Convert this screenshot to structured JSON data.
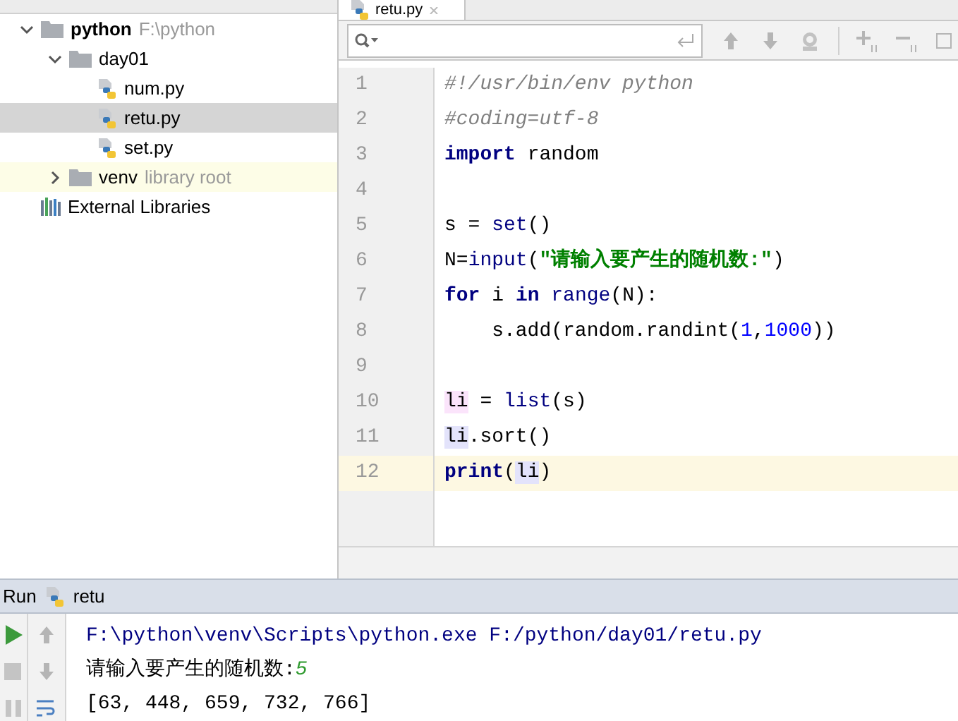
{
  "project_tree": [
    {
      "label": "python",
      "detail": "F:\\python",
      "kind": "folder",
      "bold": true,
      "expanded": true,
      "children": [
        {
          "label": "day01",
          "kind": "folder",
          "expanded": true,
          "children": [
            {
              "label": "num.py",
              "kind": "file",
              "selected": false
            },
            {
              "label": "retu.py",
              "kind": "file",
              "selected": true
            },
            {
              "label": "set.py",
              "kind": "file",
              "selected": false
            }
          ]
        },
        {
          "label": "venv",
          "detail": "library root",
          "kind": "folder",
          "expanded": false
        }
      ]
    },
    {
      "label": "External Libraries",
      "kind": "libraries"
    }
  ],
  "editor_tab": {
    "label": "retu.py"
  },
  "code_lines": [
    {
      "number": "1",
      "current": false,
      "tokens": [
        {
          "text": "#!/usr/bin/env python",
          "kind": "comment"
        }
      ]
    },
    {
      "number": "2",
      "current": false,
      "tokens": [
        {
          "text": "#coding=utf-8",
          "kind": "comment"
        }
      ]
    },
    {
      "number": "3",
      "current": false,
      "tokens": [
        {
          "text": "import",
          "kind": "keyword"
        },
        {
          "text": " random",
          "kind": "plain"
        }
      ]
    },
    {
      "number": "4",
      "current": false
    },
    {
      "number": "5",
      "current": false,
      "tokens": [
        {
          "text": "s = ",
          "kind": "plain"
        },
        {
          "text": "set",
          "kind": "builtin"
        },
        {
          "text": "()",
          "kind": "plain"
        }
      ]
    },
    {
      "number": "6",
      "current": false,
      "tokens": [
        {
          "text": "N=",
          "kind": "plain"
        },
        {
          "text": "input",
          "kind": "builtin"
        },
        {
          "text": "(",
          "kind": "plain"
        },
        {
          "text": "\"请输入要产生的随机数:\"",
          "kind": "string"
        },
        {
          "text": ")",
          "kind": "plain"
        }
      ]
    },
    {
      "number": "7",
      "current": false,
      "tokens": [
        {
          "text": "for",
          "kind": "keyword"
        },
        {
          "text": " i ",
          "kind": "plain"
        },
        {
          "text": "in",
          "kind": "keyword"
        },
        {
          "text": " range",
          "kind": "builtin"
        },
        {
          "text": "(N):",
          "kind": "plain"
        }
      ]
    },
    {
      "number": "8",
      "current": false,
      "tokens": [
        {
          "text": "    s.add(random.randint(",
          "kind": "plain"
        },
        {
          "text": "1",
          "kind": "number"
        },
        {
          "text": ",",
          "kind": "plain"
        },
        {
          "text": "1000",
          "kind": "number"
        },
        {
          "text": "))",
          "kind": "plain"
        }
      ]
    },
    {
      "number": "9",
      "current": false
    },
    {
      "number": "10",
      "current": false,
      "tokens": [
        {
          "text": "li",
          "kind": "write_usage"
        },
        {
          "text": " = ",
          "kind": "plain"
        },
        {
          "text": "list",
          "kind": "builtin"
        },
        {
          "text": "(s)",
          "kind": "plain"
        }
      ]
    },
    {
      "number": "11",
      "current": false,
      "tokens": [
        {
          "text": "li",
          "kind": "read_usage"
        },
        {
          "text": ".sort()",
          "kind": "plain"
        }
      ]
    },
    {
      "number": "12",
      "current": true,
      "tokens": [
        {
          "text": "print",
          "kind": "keyword"
        },
        {
          "text": "(",
          "kind": "plain"
        },
        {
          "text": "li",
          "kind": "read_usage"
        },
        {
          "text": ")",
          "kind": "plain"
        }
      ]
    }
  ],
  "run_panel": {
    "title": "Run",
    "config": "retu",
    "output": [
      {
        "parts": [
          {
            "text": "F:\\python\\venv\\Scripts\\python.exe F:/python/day01/retu.py",
            "kind": "command"
          }
        ]
      },
      {
        "parts": [
          {
            "text": "请输入要产生的随机数:",
            "kind": "normal"
          },
          {
            "text": "5",
            "kind": "user_input"
          }
        ]
      },
      {
        "parts": [
          {
            "text": "[63, 448, 659, 732, 766]",
            "kind": "normal"
          }
        ]
      }
    ]
  }
}
